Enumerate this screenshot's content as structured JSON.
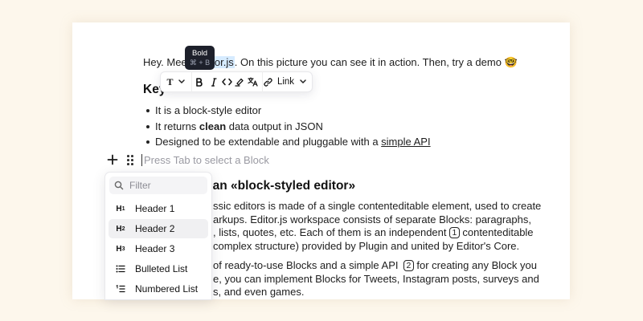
{
  "colors": {
    "background": "#fdf7ec",
    "selection": "#d6ebff",
    "tooltip": "#1d202b"
  },
  "paragraph1": {
    "before": "Hey. Meet t",
    "highlight": "Editor.js",
    "after": ". On this picture you can see it in action. Then, try a demo",
    "emoji": "🤓"
  },
  "tooltip": {
    "title": "Bold",
    "shortcut": "⌘ + B"
  },
  "toolbar": {
    "convert_icon": "T",
    "link_label": "Link"
  },
  "heading1": {
    "text": "Key"
  },
  "features": [
    {
      "pre": "It is a block-style editor",
      "bold": "",
      "post": ""
    },
    {
      "pre": "It returns ",
      "bold": "clean",
      "post": " data output in JSON"
    },
    {
      "pre": "Designed to be extendable and pluggable with a ",
      "bold": "",
      "post": "",
      "link": "simple API"
    }
  ],
  "new_block": {
    "placeholder": "Press Tab to select a Block"
  },
  "heading2": {
    "text": "ean «block-styled editor»"
  },
  "paragraph2": {
    "line1": "ssic editors is made of a single contenteditable element, used to create",
    "line2": "arkups. Editor.js workspace consists of separate Blocks: paragraphs,",
    "line3_pre": ", lists, quotes, etc. Each of them is an independent",
    "line3_badge": "1",
    "line3_post": "contenteditable",
    "line4": "complex structure) provided by Plugin and united by Editor's Core."
  },
  "paragraph3": {
    "line1_pre": "of ready-to-use Blocks and a simple API",
    "line1_badge": "2",
    "line1_post": "for creating any Block you",
    "line2": "e, you can implement Blocks for Tweets, Instagram posts, surveys and",
    "line3": "s, and even games."
  },
  "toolbox": {
    "search_placeholder": "Filter",
    "items": [
      {
        "label": "Header 1",
        "icon": "H1"
      },
      {
        "label": "Header 2",
        "icon": "H2"
      },
      {
        "label": "Header 3",
        "icon": "H3"
      },
      {
        "label": "Bulleted List",
        "icon": "bulleted-list-icon"
      },
      {
        "label": "Numbered List",
        "icon": "numbered-list-icon"
      }
    ]
  }
}
